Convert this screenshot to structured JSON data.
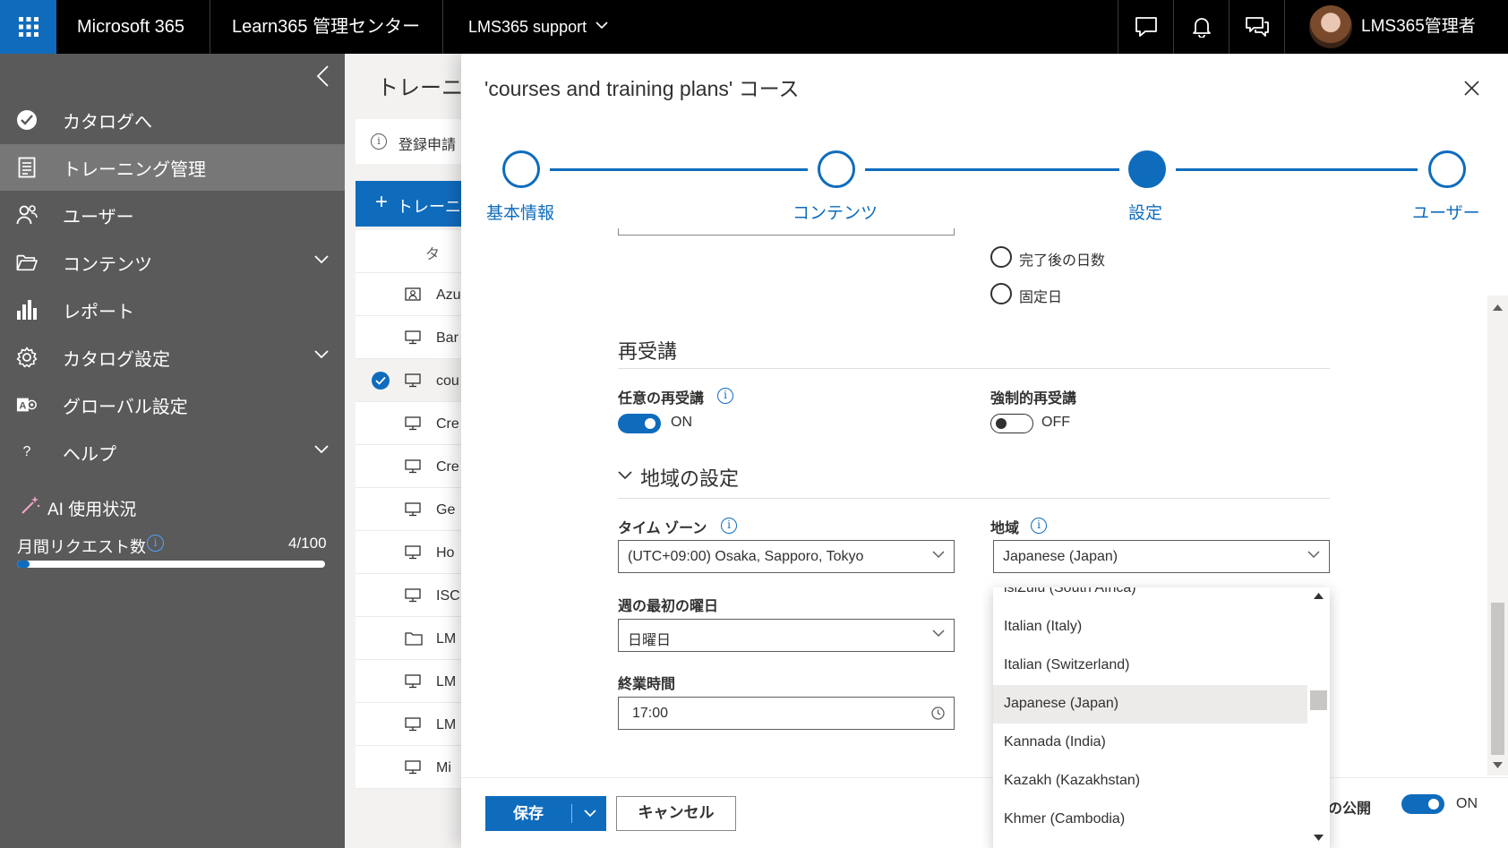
{
  "topbar": {
    "brand": "Microsoft 365",
    "app_title": "Learn365 管理センター",
    "tenant": "LMS365 support",
    "user_name": "LMS365管理者",
    "icons": [
      "app-launcher-icon",
      "chevron-down-icon",
      "chat-icon",
      "bell-icon",
      "feedback-icon"
    ]
  },
  "sidebar": {
    "items": [
      {
        "label": "カタログへ",
        "icon": "check-circle-icon",
        "expandable": false,
        "selected": false
      },
      {
        "label": "トレーニング管理",
        "icon": "clipboard-icon",
        "expandable": false,
        "selected": true
      },
      {
        "label": "ユーザー",
        "icon": "users-icon",
        "expandable": false,
        "selected": false
      },
      {
        "label": "コンテンツ",
        "icon": "folder-icon",
        "expandable": true,
        "selected": false
      },
      {
        "label": "レポート",
        "icon": "bar-chart-icon",
        "expandable": false,
        "selected": false
      },
      {
        "label": "カタログ設定",
        "icon": "gear-icon",
        "expandable": true,
        "selected": false
      },
      {
        "label": "グローバル設定",
        "icon": "admin-icon",
        "expandable": false,
        "selected": false
      },
      {
        "label": "ヘルプ",
        "icon": "question-icon",
        "expandable": true,
        "selected": false
      }
    ],
    "ai_usage_title": "AI 使用状況",
    "monthly_requests_label": "月間リクエスト数",
    "monthly_requests_value": "4/100",
    "monthly_requests_fraction": 0.04
  },
  "background": {
    "page_title": "トレーニン",
    "info_text": "登録申請",
    "add_button": "トレーニ",
    "column_header": "タ",
    "rows": [
      "Azu",
      "Bar",
      "cou",
      "Cre",
      "Cre",
      "Ge",
      "Ho",
      "ISC",
      "LM",
      "LM",
      "LM",
      "Mi"
    ],
    "row_icons": [
      "presenter-icon",
      "monitor-icon",
      "monitor-icon",
      "monitor-icon",
      "monitor-icon",
      "monitor-icon",
      "monitor-icon",
      "monitor-icon",
      "folder-icon",
      "monitor-icon",
      "monitor-icon",
      "monitor-icon"
    ],
    "selected_row_index": 2
  },
  "panel": {
    "title": "'courses and training plans' コース",
    "steps": [
      {
        "label": "基本情報",
        "state": "done"
      },
      {
        "label": "コンテンツ",
        "state": "done"
      },
      {
        "label": "設定",
        "state": "current"
      },
      {
        "label": "ユーザー",
        "state": "todo"
      }
    ],
    "radio_options": [
      "完了後の日数",
      "固定日"
    ],
    "reenroll": {
      "heading": "再受講",
      "optional_label": "任意の再受講",
      "optional_state": "ON",
      "forced_label": "強制的再受講",
      "forced_state": "OFF"
    },
    "region": {
      "heading": "地域の設定",
      "timezone_label": "タイム ゾーン",
      "timezone_value": "(UTC+09:00) Osaka, Sapporo, Tokyo",
      "locale_label": "地域",
      "locale_value": "Japanese (Japan)",
      "first_day_label": "週の最初の曜日",
      "first_day_value": "日曜日",
      "end_time_label": "終業時間",
      "end_time_value": "17:00",
      "locale_options": [
        "isiZulu (South Africa)",
        "Italian (Italy)",
        "Italian (Switzerland)",
        "Japanese (Japan)",
        "Kannada (India)",
        "Kazakh (Kazakhstan)",
        "Khmer (Cambodia)"
      ],
      "selected_option_index": 3
    },
    "footer": {
      "save": "保存",
      "cancel": "キャンセル",
      "publish_label": "の公開",
      "publish_state": "ON"
    }
  },
  "colors": {
    "accent": "#0f6cbd",
    "nav_bg": "#5a5a5a",
    "nav_selected": "#777777",
    "topbar": "#000000"
  }
}
